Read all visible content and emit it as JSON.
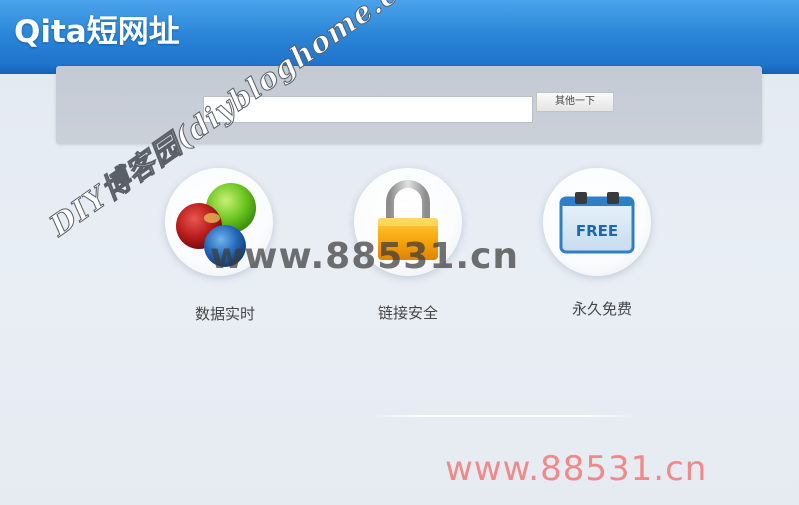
{
  "header": {
    "logo_text": "Qita短网址"
  },
  "search": {
    "input_value": "",
    "input_placeholder": "",
    "button_label": "其他一下"
  },
  "features": [
    {
      "label": "数据实时",
      "icon": "colored-balls-icon"
    },
    {
      "label": "链接安全",
      "icon": "padlock-icon"
    },
    {
      "label": "永久免费",
      "icon": "free-calendar-icon",
      "icon_text": "FREE"
    }
  ],
  "watermarks": {
    "diagonal": "DIY博客园(diybloghome.com)",
    "center": "www.88531.cn",
    "bottom_right": "www.88531.cn"
  },
  "colors": {
    "header_blue": "#2c87d8",
    "panel_gray": "#c8cdd6",
    "background": "#e7ecf3"
  }
}
